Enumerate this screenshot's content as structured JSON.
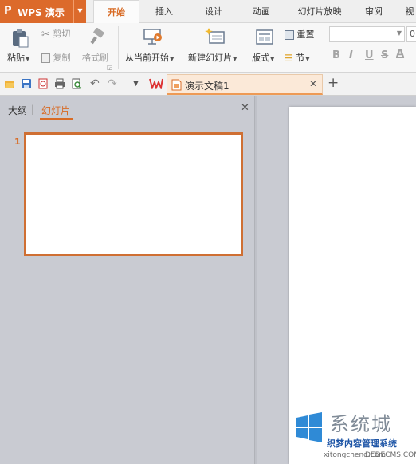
{
  "app": {
    "name": "WPS 演示",
    "logo_glyph": "P",
    "accent": "#dc6a2b"
  },
  "ribbon_tabs": [
    {
      "label": "开始",
      "active": true
    },
    {
      "label": "插入"
    },
    {
      "label": "设计"
    },
    {
      "label": "动画"
    },
    {
      "label": "幻灯片放映"
    },
    {
      "label": "审阅"
    },
    {
      "label": "视"
    }
  ],
  "ribbon": {
    "paste": "粘贴",
    "cut": "剪切",
    "copy": "复制",
    "format_painter": "格式刷",
    "from_current": "从当前开始",
    "new_slide": "新建幻灯片",
    "layout": "版式",
    "reset": "重置",
    "section": "节",
    "font_size": "0",
    "format_buttons": [
      "B",
      "I",
      "U",
      "S",
      "A"
    ]
  },
  "quick_access": {
    "icons": [
      "open-icon",
      "save-icon",
      "export-pdf-icon",
      "print-icon",
      "print-preview-icon",
      "undo-icon",
      "redo-icon",
      "customize-dropdown-icon"
    ]
  },
  "document_tab": {
    "title": "演示文稿1"
  },
  "left_pane": {
    "tabs": [
      {
        "label": "大纲"
      },
      {
        "label": "幻灯片",
        "active": true
      }
    ],
    "slides": [
      {
        "number": "1"
      }
    ]
  },
  "watermark": {
    "brand": "系统城",
    "zh": "织梦内容管理系统",
    "en": "xitongcheng.com",
    "en2": "DEDECMS.COM"
  }
}
